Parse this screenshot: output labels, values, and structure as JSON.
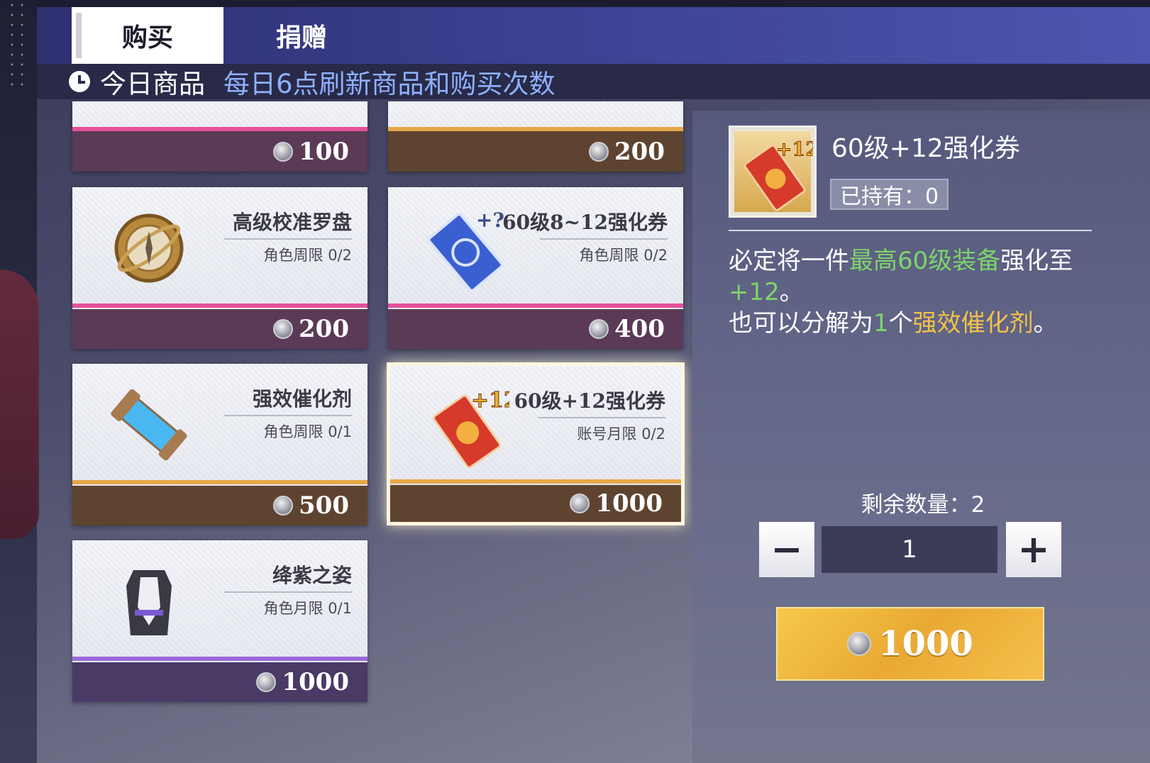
{
  "tabs": {
    "buy": "购买",
    "gift": "捐赠"
  },
  "subheader": {
    "title": "今日商品",
    "hint": "每日6点刷新商品和购买次数"
  },
  "items": [
    {
      "name": "",
      "limit": "",
      "price": "100",
      "color": "pink"
    },
    {
      "name": "",
      "limit": "",
      "price": "200",
      "color": "gold"
    },
    {
      "name": "高级校准罗盘",
      "limit": "角色周限 0/2",
      "price": "200",
      "icon": "compass-icon"
    },
    {
      "name": "60级8~12强化券",
      "limit": "角色周限 0/2",
      "price": "400",
      "icon": "blue-ticket-icon"
    },
    {
      "name": "强效催化剂",
      "limit": "角色周限 0/1",
      "price": "500",
      "icon": "catalyst-vial-icon"
    },
    {
      "name": "60级+12强化券",
      "limit": "账号月限 0/2",
      "price": "1000",
      "icon": "red-ticket-icon"
    },
    {
      "name": "绛紫之姿",
      "limit": "角色月限 0/1",
      "price": "1000",
      "icon": "outfit-icon"
    }
  ],
  "detail": {
    "title": "60级+12强化券",
    "owned": "已持有：0",
    "desc": {
      "p1a": "必定将一件",
      "p1b": "最高60级装备",
      "p1c": "强化至",
      "p1d": "+12",
      "p1e": "。",
      "p2a": "也可以分解为",
      "p2b": "1",
      "p2c": "个",
      "p2d": "强效催化剂",
      "p2e": "。"
    },
    "remain": "剩余数量：2",
    "quantity": "1",
    "minus": "−",
    "plus": "+",
    "buy_price": "1000"
  },
  "colors": {
    "accent_green": "#7ed36a",
    "accent_orange": "#f2c24a",
    "buy_button": "#f0b43c"
  }
}
